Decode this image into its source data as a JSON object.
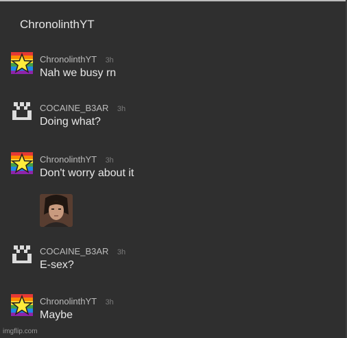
{
  "header": {
    "title": "ChronolinthYT"
  },
  "messages": [
    {
      "user": "ChronolinthYT",
      "time": "3h",
      "text": "Nah we busy rn",
      "avatar": "rainbow-star-icon"
    },
    {
      "user": "COCAINE_B3AR",
      "time": "3h",
      "text": "Doing what?",
      "avatar": "pixel-face-icon"
    },
    {
      "user": "ChronolinthYT",
      "time": "3h",
      "text": "Don't worry about it",
      "avatar": "rainbow-star-icon"
    },
    {
      "user": "COCAINE_B3AR",
      "time": "3h",
      "text": "E-sex?",
      "avatar": "pixel-face-icon"
    },
    {
      "user": "ChronolinthYT",
      "time": "3h",
      "text": "Maybe",
      "avatar": "rainbow-star-icon"
    }
  ],
  "attachment": {
    "kind": "image",
    "subject": "person-photo"
  },
  "watermark": "imgflip.com",
  "colors": {
    "background": "#2f2f2f",
    "text": "#e8e8e8",
    "username": "#bcbcbc",
    "timestamp": "#7a7a7a"
  }
}
